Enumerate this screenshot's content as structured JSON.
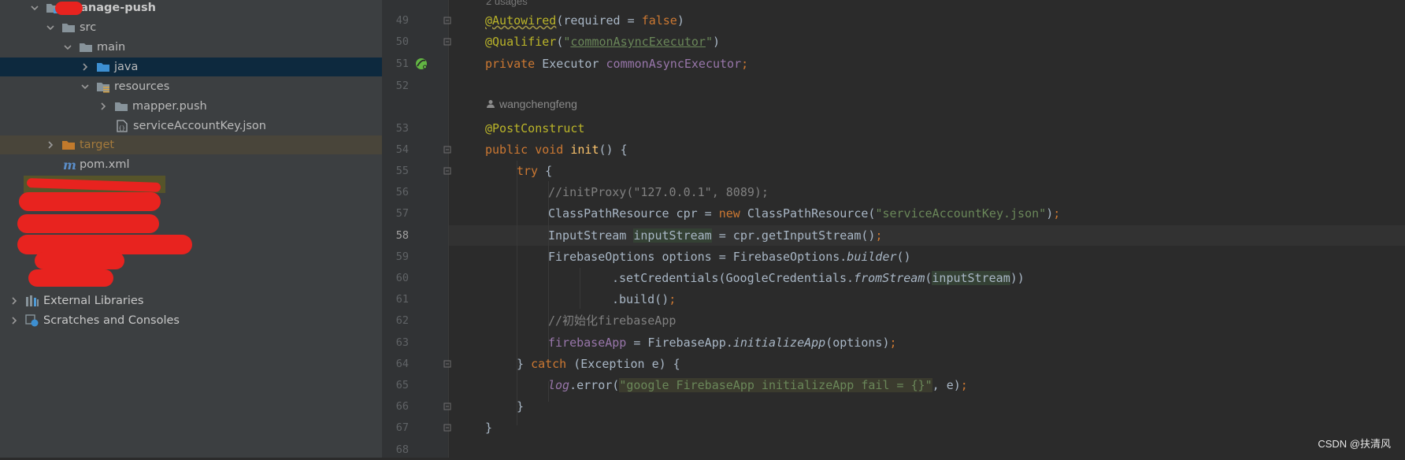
{
  "project_tree": {
    "root_module": "-manage-push",
    "items": [
      {
        "label": "src"
      },
      {
        "label": "main"
      },
      {
        "label": "java"
      },
      {
        "label": "resources"
      },
      {
        "label": "mapper.push"
      },
      {
        "label": "serviceAccountKey.json"
      },
      {
        "label": "target"
      },
      {
        "label": "pom.xml"
      }
    ],
    "external_libraries": "External Libraries",
    "scratches": "Scratches and Consoles"
  },
  "editor": {
    "usages_hint": "2 usages",
    "author_hint": "wangchengfeng",
    "current_line": "58",
    "line_numbers": [
      "49",
      "50",
      "51",
      "52",
      "53",
      "54",
      "55",
      "56",
      "57",
      "58",
      "59",
      "60",
      "61",
      "62",
      "63",
      "64",
      "65",
      "66",
      "67",
      "68"
    ]
  },
  "code": {
    "l49": {
      "annotation": "@Autowired",
      "open": "(",
      "param": "required",
      "eq": " = ",
      "value": "false",
      "close": ")"
    },
    "l50": {
      "annotation": "@Qualifier",
      "open": "(",
      "q1": "\"",
      "value": "commonAsyncExecutor",
      "q2": "\"",
      "close": ")"
    },
    "l51": {
      "kw": "private ",
      "type": "Executor ",
      "field": "commonAsyncExecutor",
      "semi": ";"
    },
    "l53": {
      "annotation": "@PostConstruct"
    },
    "l54": {
      "kw": "public void ",
      "method": "init",
      "rest": "() {"
    },
    "l55": {
      "kw": "try",
      "rest": " {"
    },
    "l56": {
      "comment": "//initProxy(\"127.0.0.1\", 8089);"
    },
    "l57": {
      "a": "ClassPathResource cpr = ",
      "kw": "new ",
      "b": "ClassPathResource(",
      "str": "\"serviceAccountKey.json\"",
      "c": ")",
      "semi": ";"
    },
    "l58": {
      "a": "InputStream ",
      "var": "inputStream",
      "b": " = cpr.getInputStream()",
      "semi": ";"
    },
    "l59": {
      "a": "FirebaseOptions options = FirebaseOptions.",
      "m": "builder",
      "b": "()"
    },
    "l60": {
      "a": ".setCredentials(GoogleCredentials.",
      "m": "fromStream",
      "b": "(",
      "var": "inputStream",
      "c": "))"
    },
    "l61": {
      "a": ".build()",
      "semi": ";"
    },
    "l62": {
      "comment": "//初始化firebaseApp"
    },
    "l63": {
      "field": "firebaseApp",
      "a": " = FirebaseApp.",
      "m": "initializeApp",
      "b": "(options)",
      "semi": ";"
    },
    "l64": {
      "a": "} ",
      "kw": "catch",
      "b": " (Exception e) {"
    },
    "l65": {
      "field": "log",
      "a": ".error(",
      "str": "\"google FirebaseApp initializeApp fail = {}\"",
      "b": ", e)",
      "semi": ";"
    },
    "l66": {
      "a": "}"
    },
    "l67": {
      "a": "}"
    }
  },
  "watermark": "CSDN @扶清风",
  "colors": {
    "keyword": "#cc7832",
    "annotation": "#bbb529",
    "string": "#6a8759",
    "field": "#9876aa",
    "comment": "#808080",
    "method": "#ffc66d",
    "selection": "#0d293e"
  }
}
